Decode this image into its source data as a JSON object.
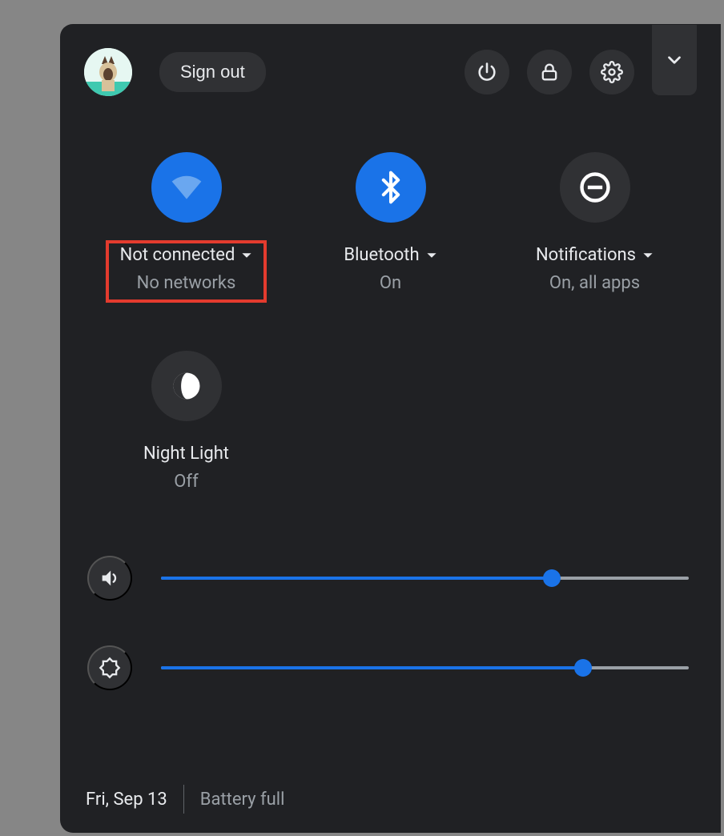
{
  "header": {
    "sign_out_label": "Sign out"
  },
  "tiles": {
    "network": {
      "label": "Not connected",
      "sub": "No networks",
      "on": true,
      "has_caret": true,
      "highlighted": true
    },
    "bluetooth": {
      "label": "Bluetooth",
      "sub": "On",
      "on": true,
      "has_caret": true
    },
    "notifications": {
      "label": "Notifications",
      "sub": "On, all apps",
      "on": false,
      "has_caret": true
    },
    "night_light": {
      "label": "Night Light",
      "sub": "Off",
      "on": false,
      "has_caret": false
    }
  },
  "sliders": {
    "volume_percent": 74,
    "brightness_percent": 80
  },
  "footer": {
    "date": "Fri, Sep 13",
    "battery": "Battery full"
  },
  "colors": {
    "accent": "#1a73e8",
    "highlight": "#e33b2e",
    "panel_bg": "#202124"
  }
}
